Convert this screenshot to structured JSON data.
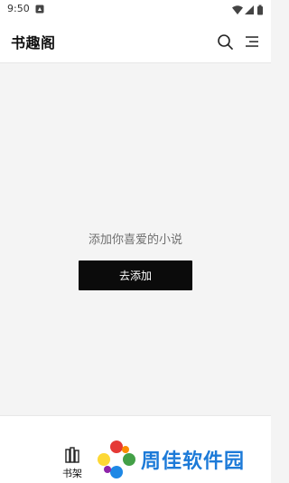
{
  "status_bar": {
    "time": "9:50",
    "notification_icon": "notification-icon",
    "icons": [
      "wifi-icon",
      "signal-icon",
      "battery-icon"
    ]
  },
  "header": {
    "title": "书趣阁",
    "search_icon": "search-icon",
    "menu_icon": "menu-icon"
  },
  "main": {
    "empty_message": "添加你喜爱的小说",
    "add_button_label": "去添加"
  },
  "bottom_nav": {
    "items": [
      {
        "label": "书架",
        "icon": "bookshelf-icon",
        "active": true
      }
    ]
  },
  "watermark": {
    "text": "周佳软件园",
    "color": "#1c7ad8"
  },
  "colors": {
    "background": "#f4f4f4",
    "button_bg": "#0b0b0b",
    "button_text": "#ffffff",
    "muted_text": "#6f6f6f"
  }
}
